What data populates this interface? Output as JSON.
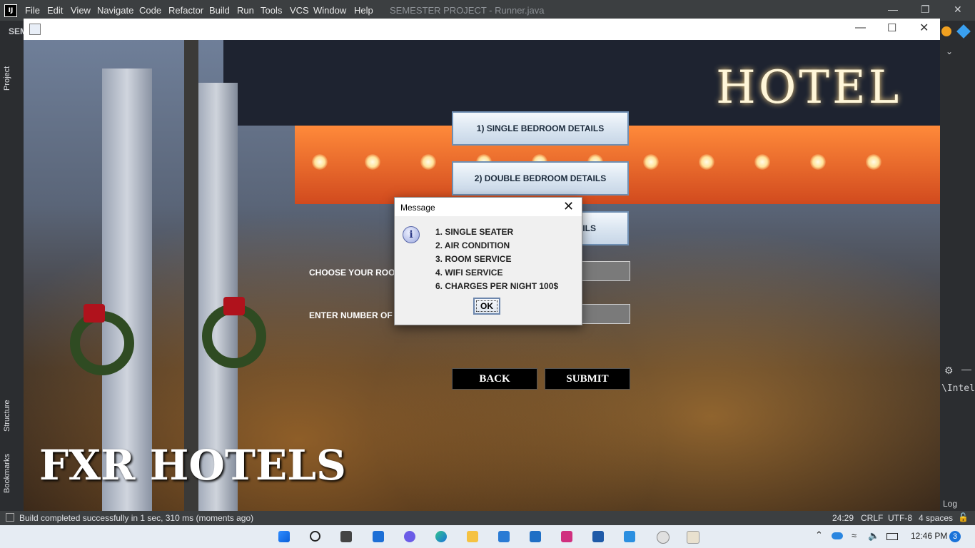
{
  "ide": {
    "logo": "IJ",
    "menu": [
      "File",
      "Edit",
      "View",
      "Navigate",
      "Code",
      "Refactor",
      "Build",
      "Run",
      "Tools",
      "VCS",
      "Window",
      "Help"
    ],
    "title": "SEMESTER PROJECT - Runner.java",
    "project_label": "SEM",
    "side_tabs": [
      "Project",
      "Structure",
      "Bookmarks"
    ],
    "right_panel_text": "\\Intel",
    "right_panel_log": "Log",
    "status_message": "Build completed successfully in 1 sec, 310 ms (moments ago)",
    "status_right": [
      "24:29",
      "CRLF",
      "UTF-8",
      "4 spaces"
    ]
  },
  "app": {
    "sign_text": "HOTEL",
    "brand_title": "FXR HOTELS",
    "buttons": {
      "single": "1) SINGLE BEDROOM DETAILS",
      "double": "2) DOUBLE BEDROOM DETAILS",
      "third_partial": "AILS",
      "back": "BACK",
      "submit": "SUBMIT"
    },
    "labels": {
      "choose_room": "CHOOSE YOUR ROOM",
      "enter_number": "ENTER NUMBER OF"
    }
  },
  "dialog": {
    "title": "Message",
    "lines": [
      "1. SINGLE SEATER",
      "2. AIR CONDITION",
      "3. ROOM SERVICE",
      "4. WIFI SERVICE",
      "6. CHARGES PER NIGHT 100$"
    ],
    "ok_label": "OK"
  },
  "taskbar": {
    "time": "12:46 PM",
    "notification_count": "3"
  },
  "colors": {
    "ide_bg": "#2b2d30",
    "ide_bar": "#3c3f41",
    "button_gradient_top": "#f4f8fc",
    "button_border": "#6f8fb3",
    "canopy": "#e0612a"
  }
}
